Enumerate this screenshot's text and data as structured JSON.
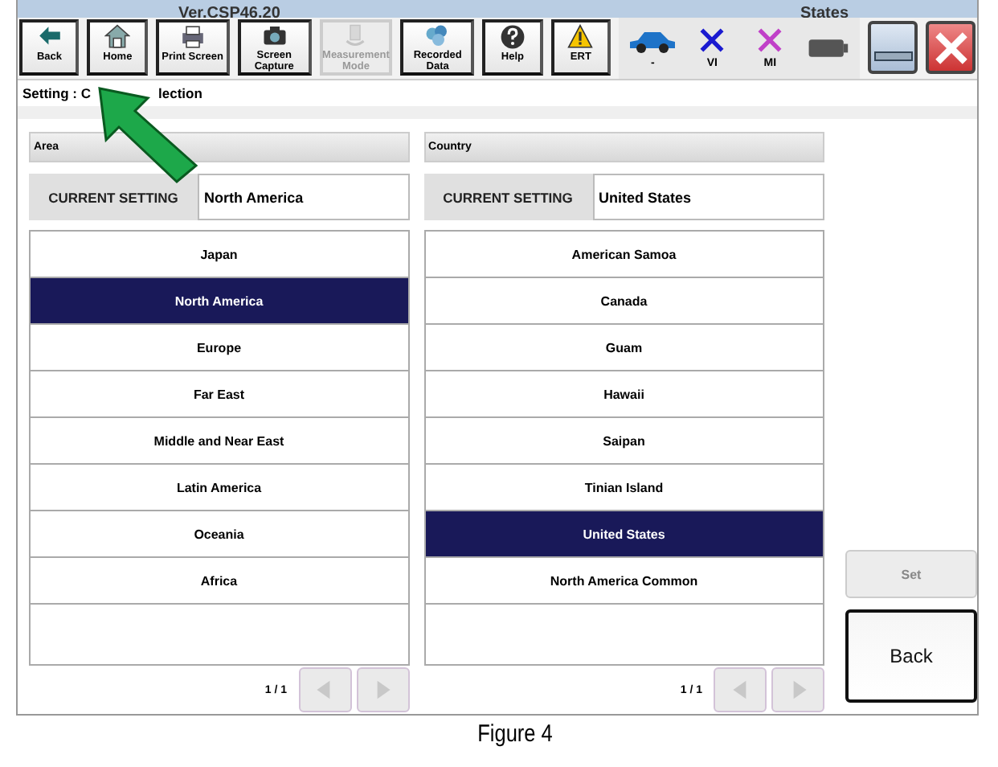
{
  "window": {
    "version": "Ver.CSP46.20",
    "status_title": "States"
  },
  "toolbar": [
    {
      "label": "Back",
      "kind": "back",
      "disabled": false
    },
    {
      "label": "Home",
      "kind": "home",
      "disabled": false
    },
    {
      "label": "Print Screen",
      "kind": "printer",
      "disabled": false
    },
    {
      "label": "Screen Capture",
      "kind": "camera",
      "disabled": false
    },
    {
      "label": "Measurement Mode",
      "kind": "meter",
      "disabled": true
    },
    {
      "label": "Recorded Data",
      "kind": "data",
      "disabled": false
    },
    {
      "label": "Help",
      "kind": "help",
      "disabled": false
    },
    {
      "label": "ERT",
      "kind": "warning",
      "disabled": false
    }
  ],
  "status": [
    {
      "label": "-",
      "kind": "car",
      "color": "#1e73c8"
    },
    {
      "label": "VI",
      "kind": "x",
      "color": "#1a1ad0"
    },
    {
      "label": "MI",
      "kind": "x",
      "color": "#c040c8"
    },
    {
      "kind": "battery",
      "color": "#555555"
    }
  ],
  "title_parts": [
    "Setting : C",
    "lection"
  ],
  "panels": [
    {
      "header": "Area",
      "current_label": "CURRENT SETTING",
      "current_value": "North America",
      "page": "1 / 1",
      "items": [
        {
          "label": "Japan",
          "selected": false
        },
        {
          "label": "North America",
          "selected": true
        },
        {
          "label": "Europe",
          "selected": false
        },
        {
          "label": "Far East",
          "selected": false
        },
        {
          "label": "Middle and Near East",
          "selected": false
        },
        {
          "label": "Latin America",
          "selected": false
        },
        {
          "label": "Oceania",
          "selected": false
        },
        {
          "label": "Africa",
          "selected": false
        }
      ]
    },
    {
      "header": "Country",
      "current_label": "CURRENT SETTING",
      "current_value": "United States",
      "page": "1 / 1",
      "items": [
        {
          "label": "American Samoa",
          "selected": false
        },
        {
          "label": "Canada",
          "selected": false
        },
        {
          "label": "Guam",
          "selected": false
        },
        {
          "label": "Hawaii",
          "selected": false
        },
        {
          "label": "Saipan",
          "selected": false
        },
        {
          "label": "Tinian Island",
          "selected": false
        },
        {
          "label": "United States",
          "selected": true
        },
        {
          "label": "North America Common",
          "selected": false
        }
      ]
    }
  ],
  "actions": [
    {
      "label": "Set",
      "disabled": true
    },
    {
      "label": "Back",
      "disabled": false
    }
  ],
  "caption": "Figure 4"
}
